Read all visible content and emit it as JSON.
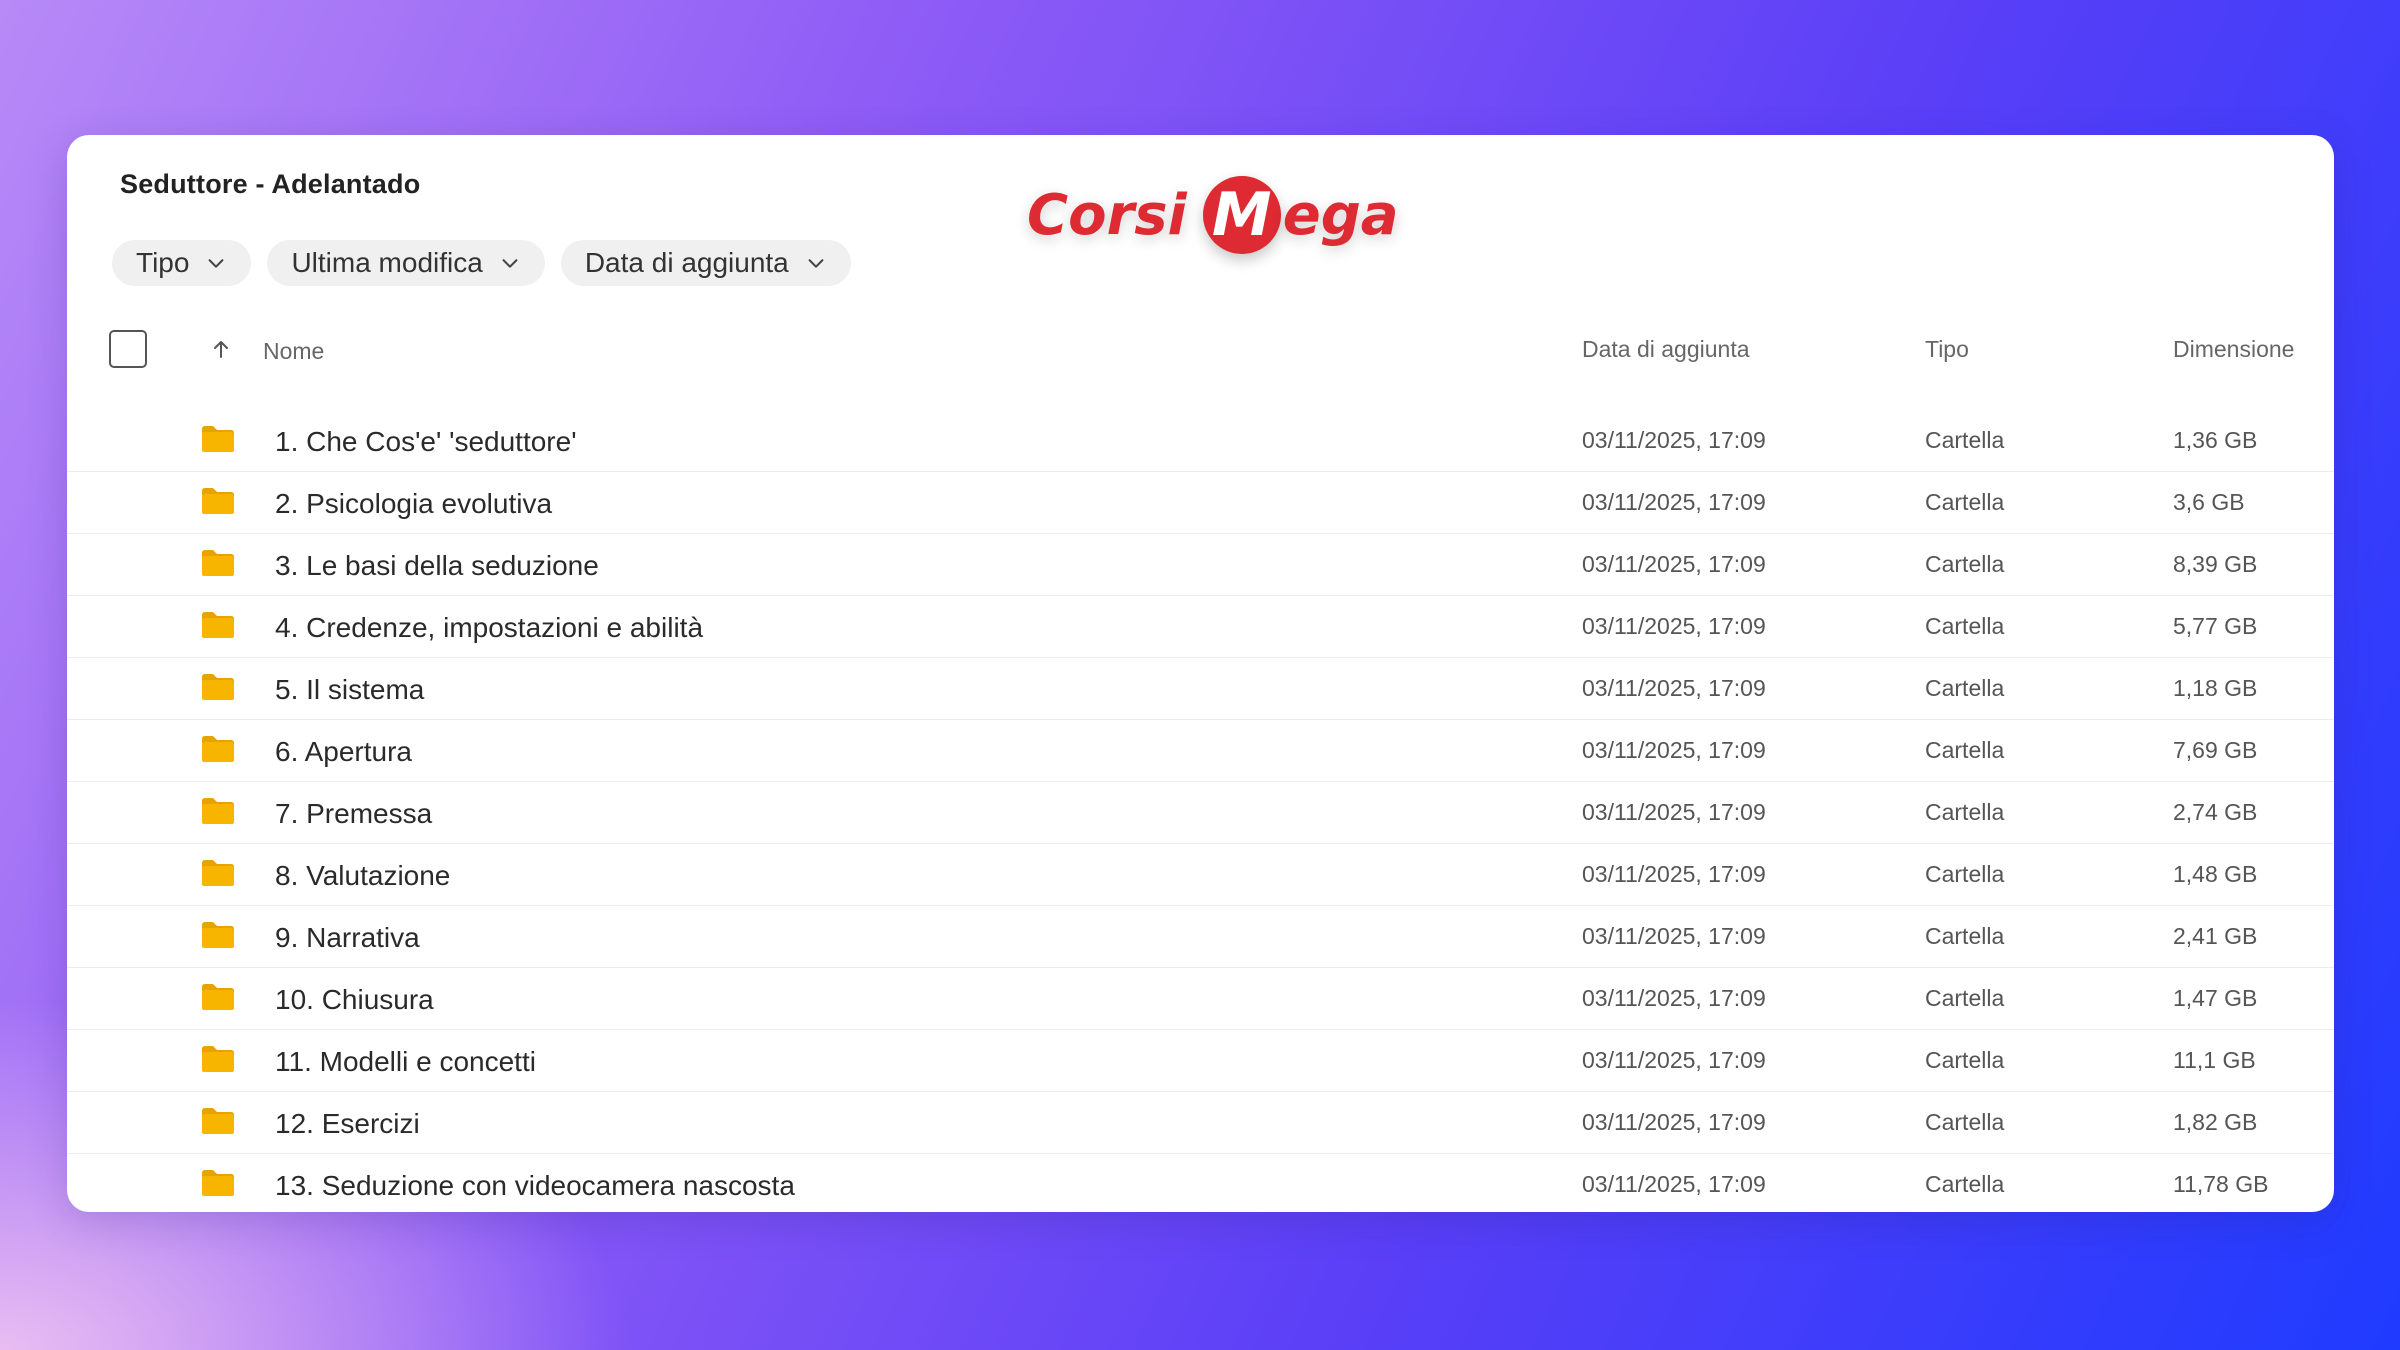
{
  "window": {
    "title": "Seduttore - Adelantado"
  },
  "logo": {
    "word1": "Corsi",
    "m": "M",
    "word2": "ega"
  },
  "filters": [
    {
      "label": "Tipo",
      "icon": "chevron-down-icon"
    },
    {
      "label": "Ultima modifica",
      "icon": "chevron-down-icon"
    },
    {
      "label": "Data di aggiunta",
      "icon": "chevron-down-icon"
    }
  ],
  "columns": {
    "name": "Nome",
    "date": "Data di aggiunta",
    "type": "Tipo",
    "size": "Dimensione",
    "sort_icon": "arrow-up-icon"
  },
  "colors": {
    "folder": "#f7b500",
    "folder_tab": "#e9a300",
    "logo_red": "#de2a32"
  },
  "rows": [
    {
      "name": "1. Che Cos'e' 'seduttore'",
      "date": "03/11/2025, 17:09",
      "type": "Cartella",
      "size": "1,36 GB"
    },
    {
      "name": "2. Psicologia evolutiva",
      "date": "03/11/2025, 17:09",
      "type": "Cartella",
      "size": "3,6 GB"
    },
    {
      "name": "3. Le basi della seduzione",
      "date": "03/11/2025, 17:09",
      "type": "Cartella",
      "size": "8,39 GB"
    },
    {
      "name": "4. Credenze, impostazioni e abilità",
      "date": "03/11/2025, 17:09",
      "type": "Cartella",
      "size": "5,77 GB"
    },
    {
      "name": "5. Il sistema",
      "date": "03/11/2025, 17:09",
      "type": "Cartella",
      "size": "1,18 GB"
    },
    {
      "name": "6. Apertura",
      "date": "03/11/2025, 17:09",
      "type": "Cartella",
      "size": "7,69 GB"
    },
    {
      "name": "7. Premessa",
      "date": "03/11/2025, 17:09",
      "type": "Cartella",
      "size": "2,74 GB"
    },
    {
      "name": "8. Valutazione",
      "date": "03/11/2025, 17:09",
      "type": "Cartella",
      "size": "1,48 GB"
    },
    {
      "name": "9. Narrativa",
      "date": "03/11/2025, 17:09",
      "type": "Cartella",
      "size": "2,41 GB"
    },
    {
      "name": "10. Chiusura",
      "date": "03/11/2025, 17:09",
      "type": "Cartella",
      "size": "1,47 GB"
    },
    {
      "name": "11. Modelli e concetti",
      "date": "03/11/2025, 17:09",
      "type": "Cartella",
      "size": "11,1 GB"
    },
    {
      "name": "12. Esercizi",
      "date": "03/11/2025, 17:09",
      "type": "Cartella",
      "size": "1,82 GB"
    },
    {
      "name": "13. Seduzione con videocamera nascosta",
      "date": "03/11/2025, 17:09",
      "type": "Cartella",
      "size": "11,78 GB"
    }
  ]
}
